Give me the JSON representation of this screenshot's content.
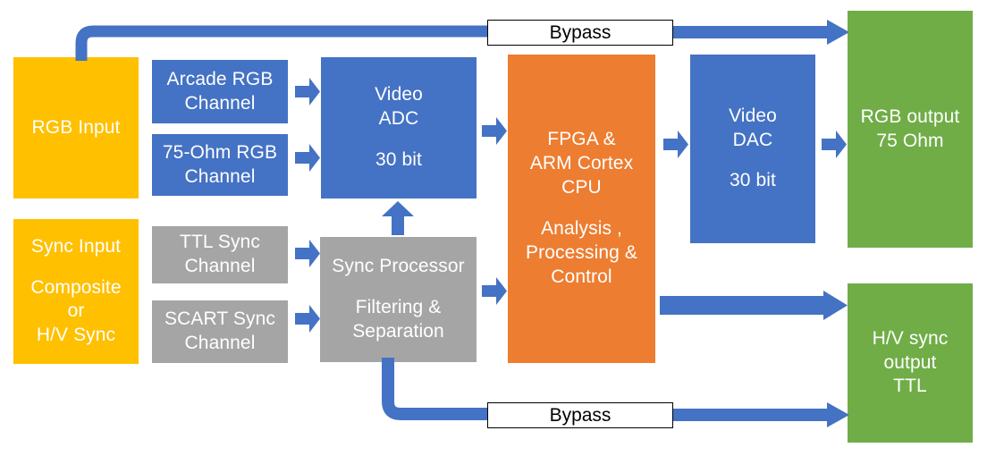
{
  "diagram": {
    "title": "Video processing signal path block diagram",
    "colors": {
      "blue": "#4472C4",
      "orange": "#ED7D31",
      "gray": "#A5A5A5",
      "gold": "#FFC000",
      "green": "#70AD47",
      "connector": "#4472C4",
      "bypass_fill": "#FFFFFF",
      "bypass_border": "#000000"
    },
    "blocks": {
      "rgb_input": {
        "label": "RGB Input"
      },
      "sync_input": {
        "line1": "Sync Input",
        "line2": "Composite",
        "line3": "or",
        "line4": "H/V Sync"
      },
      "arcade_rgb": {
        "line1": "Arcade RGB",
        "line2": "Channel"
      },
      "ohm75_rgb": {
        "line1": "75-Ohm RGB",
        "line2": "Channel"
      },
      "ttl_sync": {
        "line1": "TTL Sync",
        "line2": "Channel"
      },
      "scart_sync": {
        "line1": "SCART Sync",
        "line2": "Channel"
      },
      "video_adc": {
        "line1": "Video",
        "line2": "ADC",
        "line3": "30 bit"
      },
      "sync_processor": {
        "line1": "Sync Processor",
        "line2": "Filtering &",
        "line3": "Separation"
      },
      "fpga": {
        "line1": "FPGA &",
        "line2": "ARM Cortex",
        "line3": "CPU",
        "line4": "Analysis ,",
        "line5": "Processing &",
        "line6": "Control"
      },
      "video_dac": {
        "line1": "Video",
        "line2": "DAC",
        "line3": "30 bit"
      },
      "rgb_output": {
        "line1": "RGB output",
        "line2": "75 Ohm"
      },
      "hv_sync_output": {
        "line1": "H/V sync",
        "line2": "output",
        "line3": "TTL"
      },
      "bypass_top": {
        "label": "Bypass"
      },
      "bypass_bottom": {
        "label": "Bypass"
      }
    }
  }
}
